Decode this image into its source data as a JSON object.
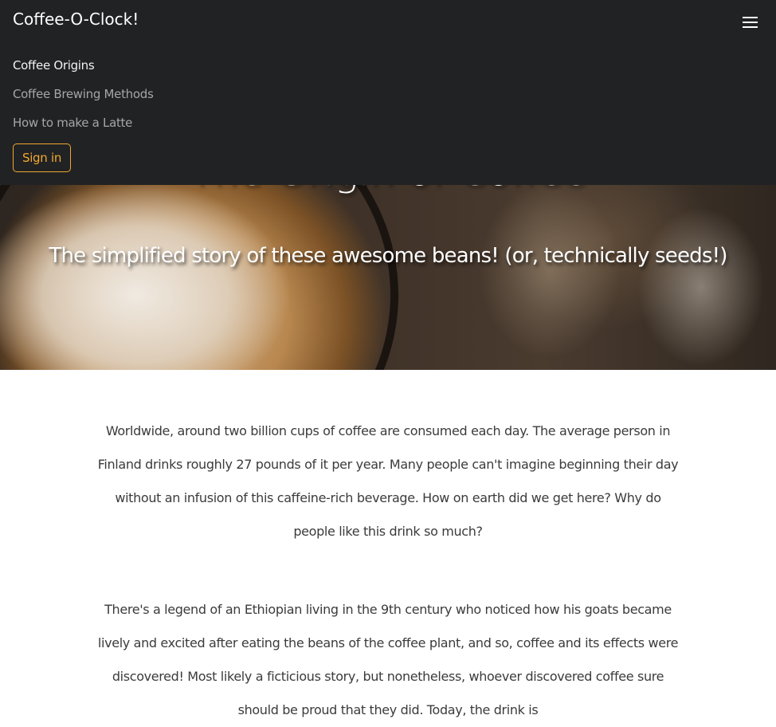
{
  "navbar": {
    "brand": "Coffee-O-Clock!",
    "menu_icon": "hamburger-menu-icon",
    "links": [
      {
        "label": "Coffee Origins",
        "active": true
      },
      {
        "label": "Coffee Brewing Methods",
        "active": false
      },
      {
        "label": "How to make a Latte",
        "active": false
      }
    ],
    "signin_label": "Sign in"
  },
  "hero": {
    "title": "The Origin of Coffee",
    "subtitle": "The simplified story of these awesome beans! (or, technically seeds!)"
  },
  "article": {
    "paragraphs": [
      "Worldwide, around two billion cups of coffee are consumed each day. The average person in Finland drinks roughly 27 pounds of it per year. Many people can't imagine beginning their day without an infusion of this caffeine-rich beverage. How on earth did we get here? Why do people like this drink so much?",
      "There's a legend of an Ethiopian living in the 9th century who noticed how his goats became lively and excited after eating the beans of the coffee plant, and so, coffee and its effects were discovered! Most likely a ficticious story, but nonetheless, whoever discovered coffee sure should be proud that they did. Today, the drink is"
    ]
  },
  "colors": {
    "navbar_bg": "#212224",
    "accent": "#f0a830",
    "nav_link_muted": "#a5a6a8",
    "body_text": "#3b3b3b"
  }
}
